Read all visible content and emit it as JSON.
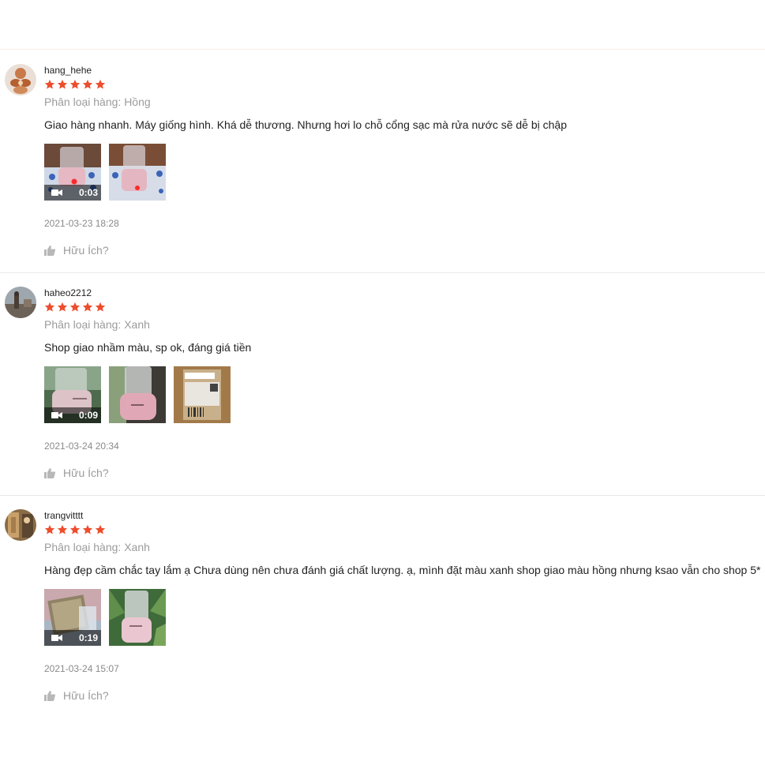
{
  "reviews": [
    {
      "username": "hang_hehe",
      "rating": 5,
      "variation": "Phân loại hàng: Hồng",
      "comment": "Giao hàng nhanh. Máy giống hình. Khá dễ thương. Nhưng hơi lo chỗ cổng sạc mà rửa nước sẽ dễ bị chập",
      "video_duration": "0:03",
      "media_count": 2,
      "date": "2021-03-23 18:28",
      "helpful_label": "Hữu Ích?"
    },
    {
      "username": "haheo2212",
      "rating": 5,
      "variation": "Phân loại hàng: Xanh",
      "comment": "Shop giao nhầm màu, sp ok, đáng giá tiền",
      "video_duration": "0:09",
      "media_count": 3,
      "date": "2021-03-24 20:34",
      "helpful_label": "Hữu Ích?"
    },
    {
      "username": "trangvitttt",
      "rating": 5,
      "variation": "Phân loại hàng: Xanh",
      "comment": "Hàng đẹp cầm chắc tay lắm ạ Chưa dùng nên chưa đánh giá chất lượng. ạ, mình đặt màu xanh shop giao màu hồng nhưng ksao vẫn cho shop 5*",
      "video_duration": "0:19",
      "media_count": 2,
      "date": "2021-03-24 15:07",
      "helpful_label": "Hữu Ích?"
    }
  ],
  "colors": {
    "star": "#ee4d2d",
    "muted": "#9b9b9b",
    "separator": "#e8e8e8"
  },
  "icons": {
    "star": "star-icon",
    "video": "video-camera-icon",
    "helpful": "thumbs-up-icon"
  }
}
